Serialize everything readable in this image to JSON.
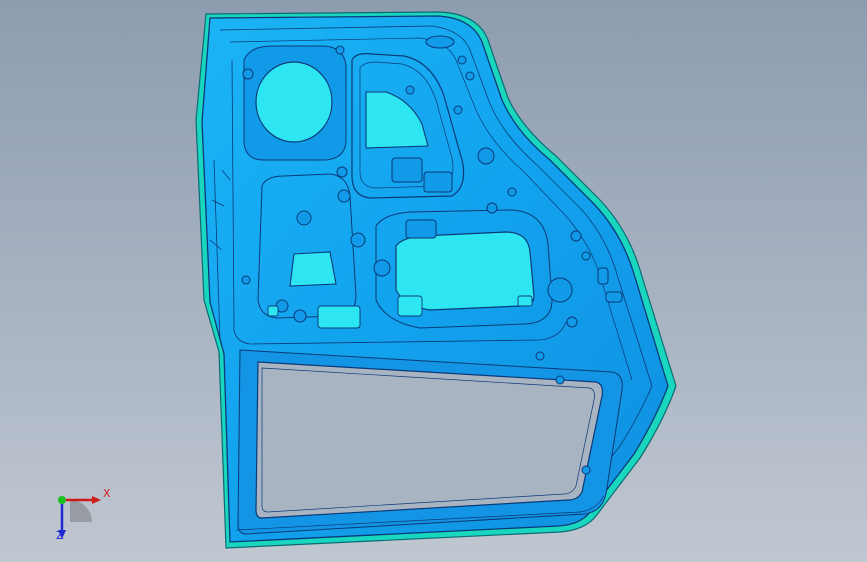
{
  "viewport": {
    "background_top": "#8e9cb0",
    "background_bottom": "#c0c7d1"
  },
  "model": {
    "part_color": "#14a6f0",
    "cutout_color": "#2ee6f2",
    "edge_color": "#0b3a78",
    "flange_color": "#18d8c0"
  },
  "triad": {
    "x_label": "X",
    "z_label": "Z",
    "x_color": "#d11a1a",
    "y_color": "#19c21f",
    "z_color": "#1f2bd0"
  }
}
